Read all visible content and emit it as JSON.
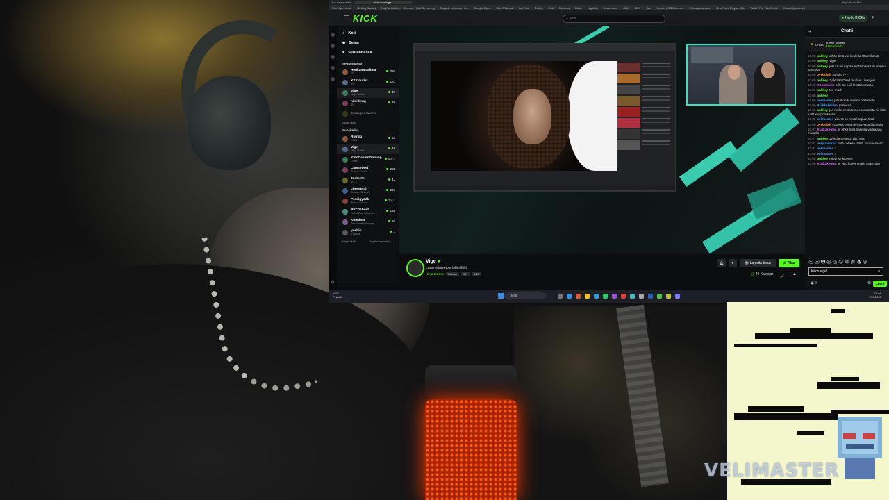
{
  "browser": {
    "tabs": [
      "Tuo kirjanmerkit",
      "kick.com/vige",
      "Kirjaudu sisään"
    ],
    "bookmarks": [
      "Tuo kirjanmerkit",
      "Getting Started",
      "PayPal Wallet",
      "Browse - Kick Streaming",
      "Support velimaster s.o.",
      "Google Maps",
      "Siisi Webmail",
      "YouTube",
      "Twitch",
      "Kick",
      "Reviews",
      "Bitnix",
      "Nightbot",
      "Streamlabs",
      "CDK",
      "BDG",
      "Spu",
      "Games | GSIDetected",
      "Pelmeponsibnum",
      "One Piece English Sub",
      "Watch The Wild Robot",
      "Muut kirjanmerkit"
    ]
  },
  "topbar": {
    "logo": "KICK",
    "search_placeholder": "Etsi",
    "login_label": "Hanki KICKs"
  },
  "sidebar": {
    "nav": [
      {
        "label": "Koti",
        "icon": "home-icon"
      },
      {
        "label": "Selaa",
        "icon": "browse-icon"
      },
      {
        "label": "Seurannassa",
        "icon": "heart-icon"
      }
    ],
    "following_title": "Seurannassa",
    "following": [
      {
        "name": "HenkanMaailma",
        "cat": "IRL",
        "viewers": "385"
      },
      {
        "name": "XXXtourist",
        "cat": "IRL",
        "viewers": "121"
      },
      {
        "name": "Vige",
        "cat": "Ninja Golden",
        "viewers": "49"
      },
      {
        "name": "hiisidewg",
        "cat": "IRL",
        "viewers": "29"
      },
      {
        "name": "Jurasgoodworld",
        "cat": "",
        "viewers": ""
      }
    ],
    "show_all_1": "Näytä lisää",
    "suggested_title": "Suositellut",
    "suggested": [
      {
        "name": "Rolrski",
        "cat": "Chatit",
        "viewers": "55"
      },
      {
        "name": "Vige",
        "cat": "Ninja Golden",
        "viewers": "49"
      },
      {
        "name": "KinoCasinoGaming",
        "cat": "Chatit",
        "viewers": "5,4 t."
      },
      {
        "name": "Classybeef",
        "cat": "Slots & Casino",
        "viewers": "268"
      },
      {
        "name": "Justketh",
        "cat": "IRL",
        "viewers": "41"
      },
      {
        "name": "cheesbrah",
        "cat": "Counter-Strike 2",
        "viewers": "206"
      },
      {
        "name": "Prodigyddk",
        "cat": "Slots & Casino",
        "viewers": "1,4 t."
      },
      {
        "name": "R6TZGhost",
        "cat": "Call of Duty: Warzone",
        "viewers": "146"
      },
      {
        "name": "Kinetiosr",
        "cat": "Fire Emblem Engage",
        "viewers": "92"
      },
      {
        "name": "yoshio",
        "cat": "VTubers",
        "viewers": "1"
      }
    ],
    "show_more": "Näytä lisää",
    "show_less": "Näytä vähemmän"
  },
  "stream": {
    "name": "Vige",
    "title": "Lasarvata/vetoja tiitän iltöiti",
    "category": "Ninja Golden",
    "tags": [
      "Finnish",
      "18+",
      "K18"
    ],
    "gift_label": "Lahjoita tilaus",
    "sub_label": "Tilaa",
    "viewers": "49 Katsojat"
  },
  "chat": {
    "title": "Chatti",
    "pinned_user1": "meko_Espoo",
    "pinned_user2": "Marianne82",
    "pinned_prefix": "DNafe",
    "messages": [
      {
        "t": "10.05",
        "u": "ankkey",
        "c": "#53fc18",
        "m": "eihän tietä voi kuulella ritlaimillassä"
      },
      {
        "t": "10.05",
        "u": "ankkey",
        "c": "#53fc18",
        "m": "Vige"
      },
      {
        "t": "10.05",
        "u": "ankkey",
        "c": "#53fc18",
        "m": "just ku on nopilla tentäimässä nii iloinen sävessa"
      },
      {
        "t": "10.05",
        "u": "Jyrkkiläh",
        "c": "#ff9a3c",
        "m": "Jo joku???"
      },
      {
        "t": "10.06",
        "u": "ankkey",
        "c": "#53fc18",
        "m": "Jyrkkiläh Dead or alive - bon jovi"
      },
      {
        "t": "10.06",
        "u": "Koomisinis",
        "c": "#e06cff",
        "m": "sille on noill lentäis vitussa"
      },
      {
        "t": "10.06",
        "u": "ankkey",
        "c": "#53fc18",
        "m": "too much"
      },
      {
        "t": "10.06",
        "u": "ankkey",
        "c": "#53fc18",
        "m": ""
      },
      {
        "t": "10.06",
        "u": "velimaster",
        "c": "#4aa3ff",
        "m": "jätkät on kumpikin bottometa"
      },
      {
        "t": "10.06",
        "u": "Kuikkakeulsa",
        "c": "#4aa3ff",
        "m": "pasuaaa"
      },
      {
        "t": "10.06",
        "u": "ankkey",
        "c": "#53fc18",
        "m": "jos mulle en sattunu eurojaakiita nii sitte juhlitaan porukassa"
      },
      {
        "t": "10.06",
        "u": "velimaster",
        "c": "#4aa3ff",
        "m": "vittu tä on hyvä kraputa tiltal"
      },
      {
        "t": "10.06",
        "u": "Jyrkkiläh",
        "c": "#ff9a3c",
        "m": "Lotossa tämän ennätyspotti lämettä"
      },
      {
        "t": "10.07",
        "u": "Kukkakeulsa",
        "c": "#e06cff",
        "m": "ei ehkä mitä pasissa vailkala ja muualla"
      },
      {
        "t": "10.07",
        "u": "ankkey",
        "c": "#53fc18",
        "m": "Jyrkkiläh Haista vittu sitte"
      },
      {
        "t": "10.07",
        "u": "verpupuarva",
        "c": "#4aa3ff",
        "m": "mitä pakkea täältä kuunnellaan?"
      },
      {
        "t": "10.07",
        "u": "velimaster",
        "c": "#4aa3ff",
        "m": ":("
      },
      {
        "t": "10.08",
        "u": "velimaster",
        "c": "#4aa3ff",
        "m": ":("
      },
      {
        "t": "10.08",
        "u": "ankkey",
        "c": "#53fc18",
        "m": "mitäh se kibetee"
      },
      {
        "t": "10.08",
        "u": "Kukkakeulsa",
        "c": "#e06cff",
        "m": "ei vittu kovemmalle vaan tolto"
      }
    ],
    "input_value": "kiitos vige!",
    "count": "0",
    "send_label": "Chatti"
  },
  "taskbar": {
    "weather_temp": "+5°C",
    "weather_desc": "Pilvistä",
    "search_placeholder": "Etsi",
    "time": "10.08",
    "date": "17.1.2025"
  },
  "overlay": {
    "brand_text": "VELIMASTER"
  }
}
